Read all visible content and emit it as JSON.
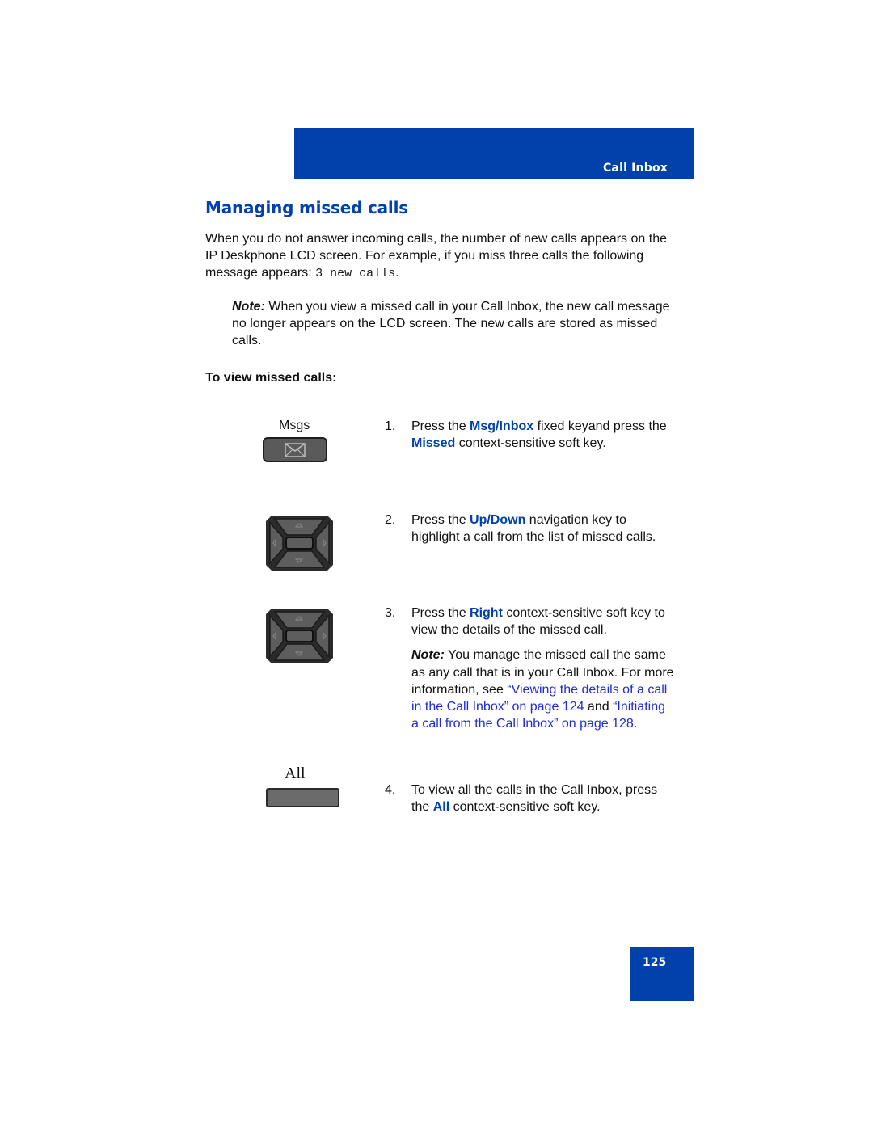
{
  "header": {
    "section_label": "Call Inbox"
  },
  "title": "Managing missed calls",
  "intro": {
    "text": "When you do not answer incoming calls, the number of new calls appears on the IP Deskphone LCD screen. For example, if you miss three calls the following message appears: ",
    "code": "3 new calls",
    "end": "."
  },
  "note1": {
    "label": "Note:",
    "text": " When you view a missed call in your Call Inbox, the new call message no longer appears on the LCD screen. The new calls are stored as missed calls."
  },
  "procedure_heading": "To view missed calls:",
  "keys": {
    "msgs_label": "Msgs",
    "all_label": "All"
  },
  "steps": [
    {
      "num": "1.",
      "parts": [
        "Press the ",
        "Msg/Inbox",
        " fixed keyand press the ",
        "Missed",
        " context-sensitive soft key."
      ]
    },
    {
      "num": "2.",
      "parts": [
        "Press the ",
        "Up/Down",
        " navigation key to highlight a call from the list of missed calls."
      ]
    },
    {
      "num": "3.",
      "parts": [
        "Press the ",
        "Right",
        " context-sensitive soft key to view the details of the missed call."
      ],
      "note": {
        "label": "Note:",
        "text": " You manage the missed call the same as any call that is in your Call Inbox. For more information, see ",
        "link1": "“Viewing the details of a call in the Call Inbox” on page 124",
        "and": " and ",
        "link2": "“Initiating a call from the Call Inbox” on page 128",
        "end": "."
      }
    },
    {
      "num": "4.",
      "parts": [
        "To view all the calls in the Call Inbox, press the ",
        "All",
        " context-sensitive soft key."
      ]
    }
  ],
  "page_number": "125",
  "colors": {
    "brand_blue": "#0041ab",
    "link_blue": "#1f2bd6"
  }
}
